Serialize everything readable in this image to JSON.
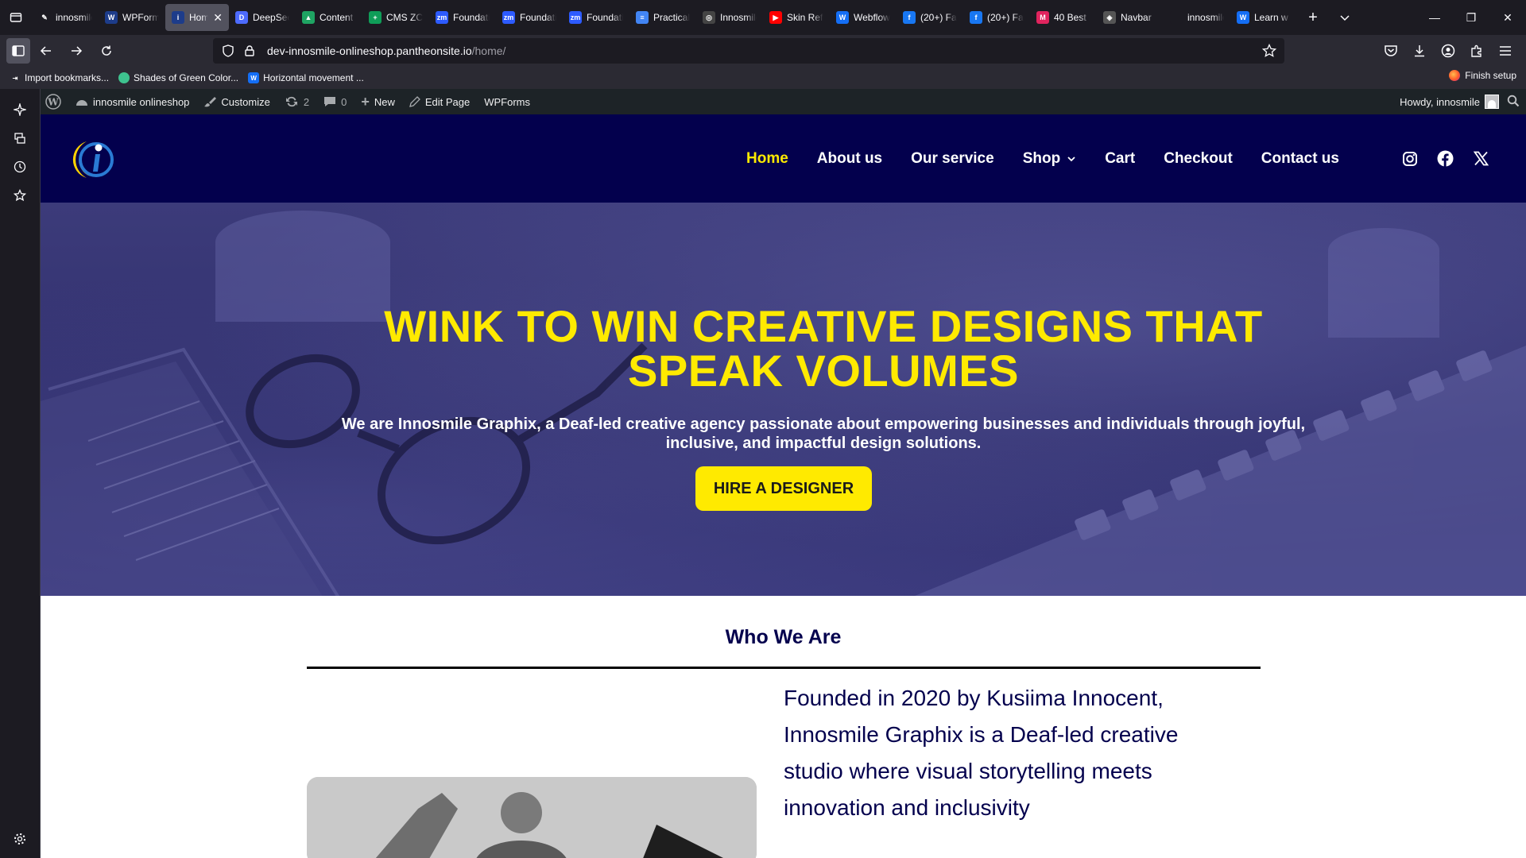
{
  "browser": {
    "tabs": [
      {
        "label": "innosmile",
        "fav_color": "#1c1b22",
        "fav_glyph": "✎"
      },
      {
        "label": "WPForms",
        "fav_color": "#1d3c8a",
        "fav_glyph": "W"
      },
      {
        "label": "Home",
        "fav_color": "#1d3c8a",
        "fav_glyph": "i",
        "active": true
      },
      {
        "label": "DeepSeek",
        "fav_color": "#4d6bfe",
        "fav_glyph": "D"
      },
      {
        "label": "Content",
        "fav_color": "#1fa463",
        "fav_glyph": "▲"
      },
      {
        "label": "CMS ZC",
        "fav_color": "#0f9d58",
        "fav_glyph": "+"
      },
      {
        "label": "Foundation",
        "fav_color": "#2d5bff",
        "fav_glyph": "zm"
      },
      {
        "label": "Foundation",
        "fav_color": "#2d5bff",
        "fav_glyph": "zm"
      },
      {
        "label": "Foundation",
        "fav_color": "#2d5bff",
        "fav_glyph": "zm"
      },
      {
        "label": "Practical",
        "fav_color": "#4285f4",
        "fav_glyph": "≡"
      },
      {
        "label": "Innosmile",
        "fav_color": "#444",
        "fav_glyph": "◎"
      },
      {
        "label": "Skin Ref",
        "fav_color": "#ff0000",
        "fav_glyph": "▶"
      },
      {
        "label": "Webflow",
        "fav_color": "#146ef5",
        "fav_glyph": "W"
      },
      {
        "label": "(20+) Fa",
        "fav_color": "#1877f2",
        "fav_glyph": "f"
      },
      {
        "label": "(20+) Fa",
        "fav_color": "#1877f2",
        "fav_glyph": "f"
      },
      {
        "label": "40 Best",
        "fav_color": "#e0245e",
        "fav_glyph": "M"
      },
      {
        "label": "Navbar",
        "fav_color": "#555",
        "fav_glyph": "◈"
      },
      {
        "label": "innosmile.gr",
        "fav_color": "#1c1b22",
        "fav_glyph": ""
      },
      {
        "label": "Learn w",
        "fav_color": "#146ef5",
        "fav_glyph": "W"
      }
    ],
    "url_host": "dev-innosmile-onlineshop.pantheonsite.io",
    "url_path": "/home/",
    "bookmarks": [
      {
        "label": "Import bookmarks...",
        "icon_color": "transparent",
        "glyph": "⇥"
      },
      {
        "label": "Shades of Green Color...",
        "icon_color": "#3ec28f",
        "glyph": ""
      },
      {
        "label": "Horizontal movement ...",
        "icon_color": "#146ef5",
        "glyph": "W"
      }
    ],
    "finish_setup": "Finish setup"
  },
  "wp_admin_bar": {
    "site_name": "innosmile onlineshop",
    "customize": "Customize",
    "updates_count": "2",
    "comments_count": "0",
    "new": "New",
    "edit_page": "Edit Page",
    "wpforms": "WPForms",
    "howdy": "Howdy, innosmile"
  },
  "site": {
    "menu": [
      {
        "label": "Home",
        "current": true
      },
      {
        "label": "About us"
      },
      {
        "label": "Our service"
      },
      {
        "label": "Shop",
        "has_dropdown": true
      },
      {
        "label": "Cart"
      },
      {
        "label": "Checkout"
      },
      {
        "label": "Contact us"
      }
    ],
    "social_icons": [
      "instagram-icon",
      "facebook-icon",
      "x-twitter-icon"
    ],
    "colors": {
      "header": "#03004d",
      "accent": "#ffea00"
    }
  },
  "hero": {
    "title": "WINK TO WIN CREATIVE DESIGNS THAT SPEAK VOLUMES",
    "subtitle": "We are Innosmile Graphix, a Deaf-led creative agency passionate about empowering businesses and individuals through joyful, inclusive, and impactful design solutions.",
    "cta": "HIRE A DESIGNER"
  },
  "who_we_are": {
    "heading": "Who We Are",
    "text": "Founded in 2020 by Kusiima Innocent, Innosmile Graphix is a Deaf-led creative studio where visual storytelling meets innovation and inclusivity"
  }
}
